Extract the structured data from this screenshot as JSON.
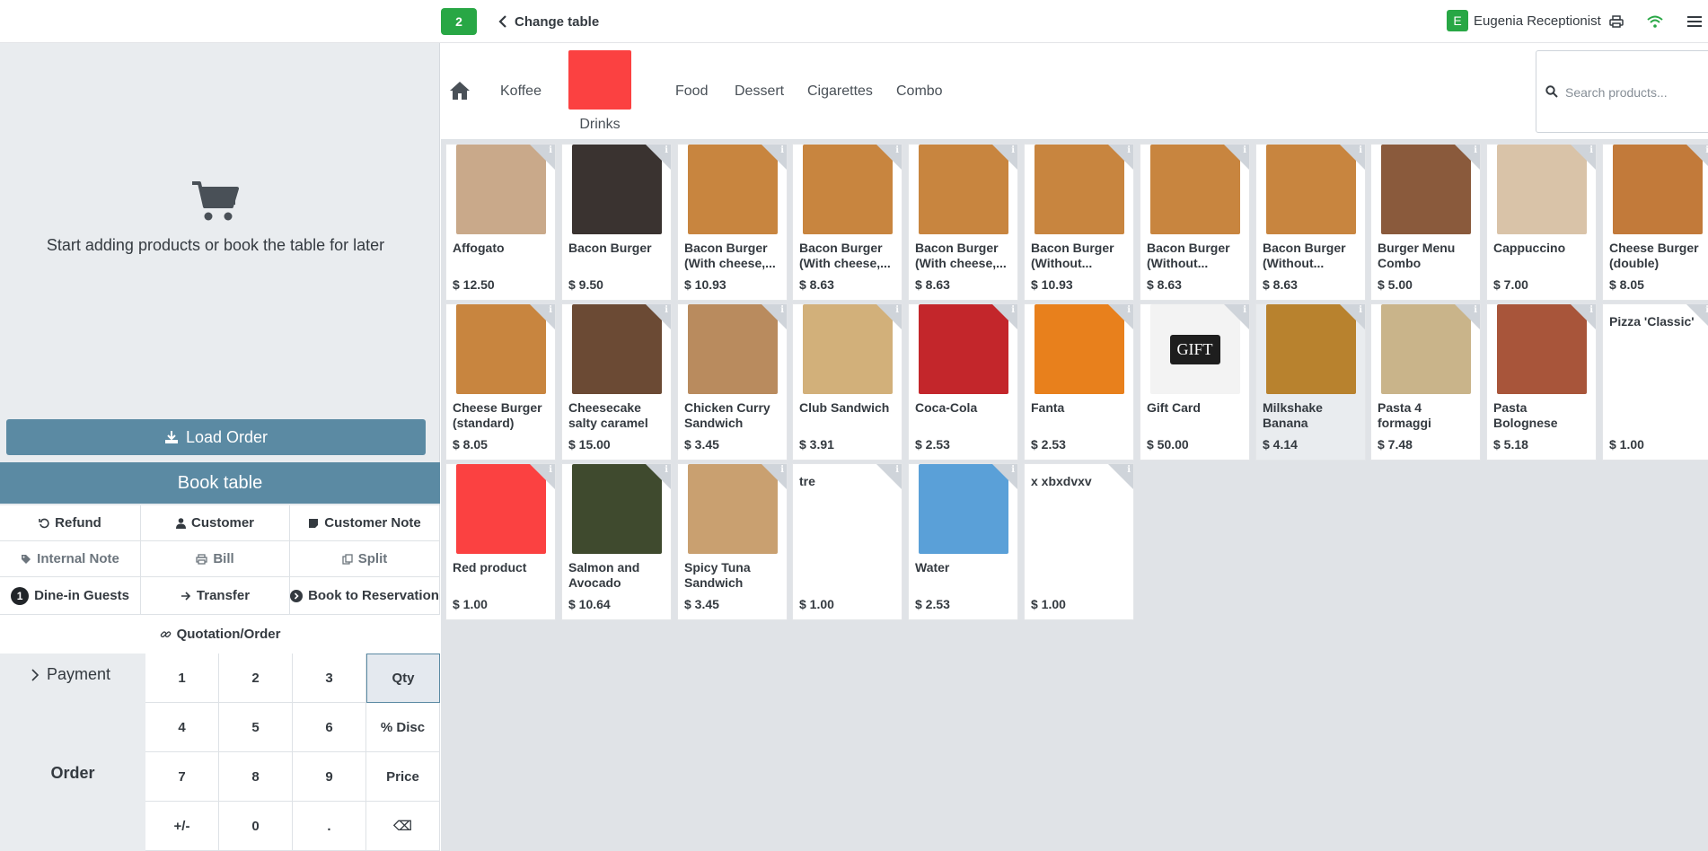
{
  "topbar": {
    "table_number": "2",
    "change_table_label": "Change table",
    "user_initial": "E",
    "user_name": "Eugenia Receptionist"
  },
  "left": {
    "empty_message": "Start adding products or book the table for later",
    "load_order_label": "Load Order",
    "book_table_label": "Book table",
    "actions": {
      "refund": "Refund",
      "customer": "Customer",
      "customer_note": "Customer Note",
      "internal_note": "Internal Note",
      "bill": "Bill",
      "split": "Split",
      "guests_count": "1",
      "dine_in_guests": "Dine-in Guests",
      "transfer": "Transfer",
      "book_to_reservation": "Book to Reservation",
      "quotation_order": "Quotation/Order"
    },
    "payment_label": "Payment",
    "order_label": "Order",
    "numpad": [
      "1",
      "2",
      "3",
      "Qty",
      "4",
      "5",
      "6",
      "% Disc",
      "7",
      "8",
      "9",
      "Price",
      "+/-",
      "0",
      ".",
      "⌫"
    ]
  },
  "categories": {
    "items": [
      "Koffee",
      "Drinks",
      "Food",
      "Dessert",
      "Cigarettes",
      "Combo"
    ],
    "drinks_color": "#fb4141"
  },
  "search": {
    "placeholder": "Search products..."
  },
  "products": [
    {
      "name": "Affogato",
      "price": "$ 12.50",
      "img": "#c9a98a"
    },
    {
      "name": "Bacon Burger",
      "price": "$ 9.50",
      "img": "#3a3330"
    },
    {
      "name": "Bacon Burger (With cheese,...",
      "price": "$ 10.93",
      "img": "#c8853f"
    },
    {
      "name": "Bacon Burger (With cheese,...",
      "price": "$ 8.63",
      "img": "#c8853f"
    },
    {
      "name": "Bacon Burger (With cheese,...",
      "price": "$ 8.63",
      "img": "#c8853f"
    },
    {
      "name": "Bacon Burger (Without...",
      "price": "$ 10.93",
      "img": "#c8853f"
    },
    {
      "name": "Bacon Burger (Without...",
      "price": "$ 8.63",
      "img": "#c8853f"
    },
    {
      "name": "Bacon Burger (Without...",
      "price": "$ 8.63",
      "img": "#c8853f"
    },
    {
      "name": "Burger Menu Combo",
      "price": "$ 5.00",
      "img": "#8a5a3c"
    },
    {
      "name": "Cappuccino",
      "price": "$ 7.00",
      "img": "#d9c3a8"
    },
    {
      "name": "Cheese Burger (double)",
      "price": "$ 8.05",
      "img": "#c27a3a"
    },
    {
      "name": "Cheese Burger (standard)",
      "price": "$ 8.05",
      "img": "#c8853f"
    },
    {
      "name": "Cheesecake salty caramel",
      "price": "$ 15.00",
      "img": "#6b4a34"
    },
    {
      "name": "Chicken Curry Sandwich",
      "price": "$ 3.45",
      "img": "#b98b5e"
    },
    {
      "name": "Club Sandwich",
      "price": "$ 3.91",
      "img": "#d2b07a"
    },
    {
      "name": "Coca-Cola",
      "price": "$ 2.53",
      "img": "#c3262b"
    },
    {
      "name": "Fanta",
      "price": "$ 2.53",
      "img": "#e8801c"
    },
    {
      "name": "Gift Card",
      "price": "$ 50.00",
      "img": "#1e1e1e",
      "gift": "GIFT"
    },
    {
      "name": "Milkshake Banana",
      "price": "$ 4.14",
      "img": "#b8822e"
    },
    {
      "name": "Pasta 4 formaggi",
      "price": "$ 7.48",
      "img": "#c9b48a"
    },
    {
      "name": "Pasta Bolognese",
      "price": "$ 5.18",
      "img": "#a8553a"
    },
    {
      "name": "Pizza 'Classic'",
      "price": "$ 1.00",
      "img": ""
    },
    {
      "name": "Red product",
      "price": "$ 1.00",
      "img": "#fb4141"
    },
    {
      "name": "Salmon and Avocado",
      "price": "$ 10.64",
      "img": "#3f4a2e"
    },
    {
      "name": "Spicy Tuna Sandwich",
      "price": "$ 3.45",
      "img": "#c9a070"
    },
    {
      "name": "tre",
      "price": "$ 1.00",
      "img": ""
    },
    {
      "name": "Water",
      "price": "$ 2.53",
      "img": "#5aa0d8"
    },
    {
      "name": "x xbxdvxv",
      "price": "$ 1.00",
      "img": ""
    }
  ]
}
